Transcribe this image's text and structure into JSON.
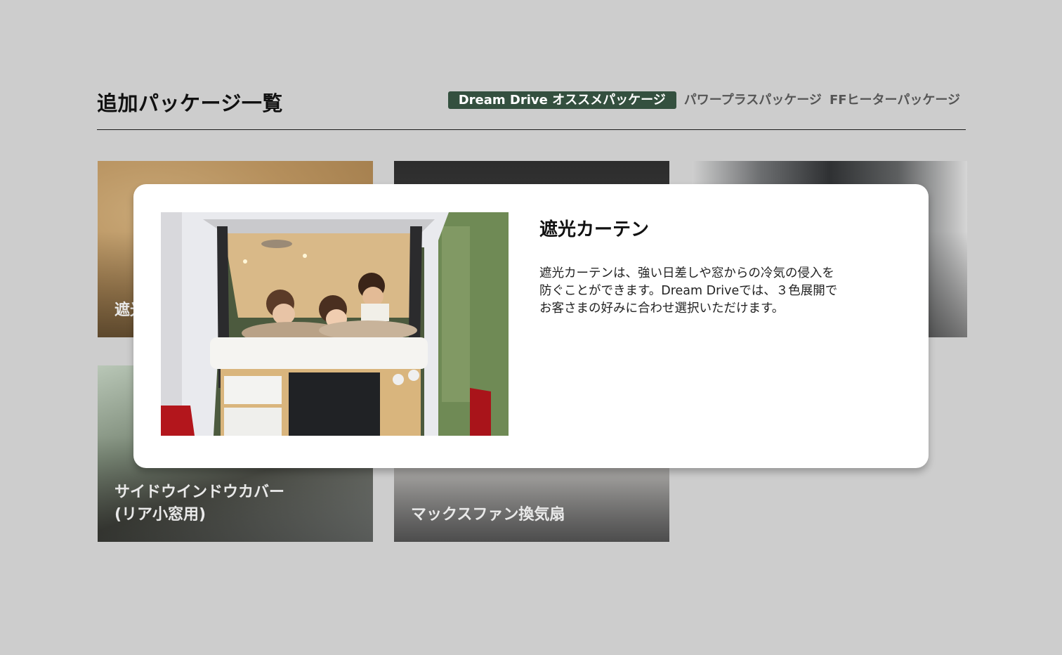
{
  "header": {
    "title": "追加パッケージ一覧",
    "tabs": [
      {
        "label": "Dream Drive オススメパッケージ",
        "active": true
      },
      {
        "label": "パワープラスパッケージ",
        "active": false
      },
      {
        "label": "FFヒーターパッケージ",
        "active": false
      }
    ]
  },
  "cards": [
    {
      "label": "遮光カーテン"
    },
    {
      "label": ""
    },
    {
      "label": ""
    },
    {
      "label": "サイドウインドウカバー\n(リア小窓用)"
    },
    {
      "label": "マックスファン換気扇"
    }
  ],
  "modal": {
    "title": "遮光カーテン",
    "description": "遮光カーテンは、強い日差しや窓からの冷気の侵入を\n防ぐことができます。Dream Driveでは、３色展開で\nお客さまの好みに合わせ選択いただけます。",
    "image_icon": "photo-van-family-icon"
  },
  "colors": {
    "background": "#cdcdcd",
    "active_tab": "#34503f",
    "modal_bg": "#ffffff"
  }
}
